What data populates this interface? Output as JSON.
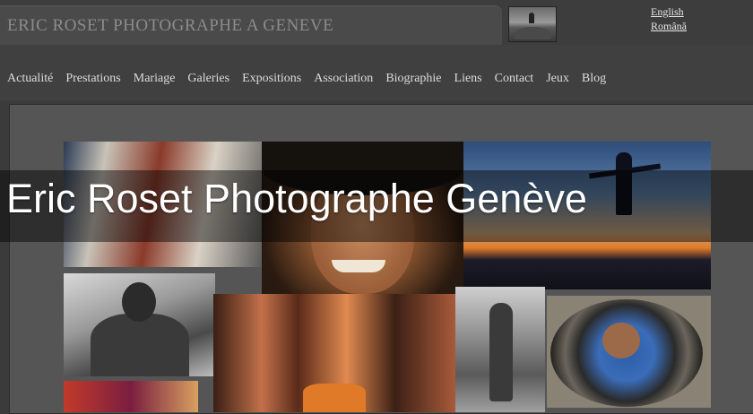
{
  "header": {
    "site_title": "ERIC ROSET PHOTOGRAPHE A GENEVE",
    "languages": [
      "English",
      "Română"
    ]
  },
  "nav": {
    "items": [
      "Actualité",
      "Prestations",
      "Mariage",
      "Galeries",
      "Expositions",
      "Association",
      "Biographie",
      "Liens",
      "Contact",
      "Jeux",
      "Blog"
    ]
  },
  "overlay": {
    "text": "Eric Roset Photographe Genève"
  },
  "colors": {
    "background": "#3b3b3b",
    "title_text": "#8c8c8c",
    "nav_text": "#dcdcdc",
    "overlay_band": "rgba(0,0,0,0.45)"
  }
}
